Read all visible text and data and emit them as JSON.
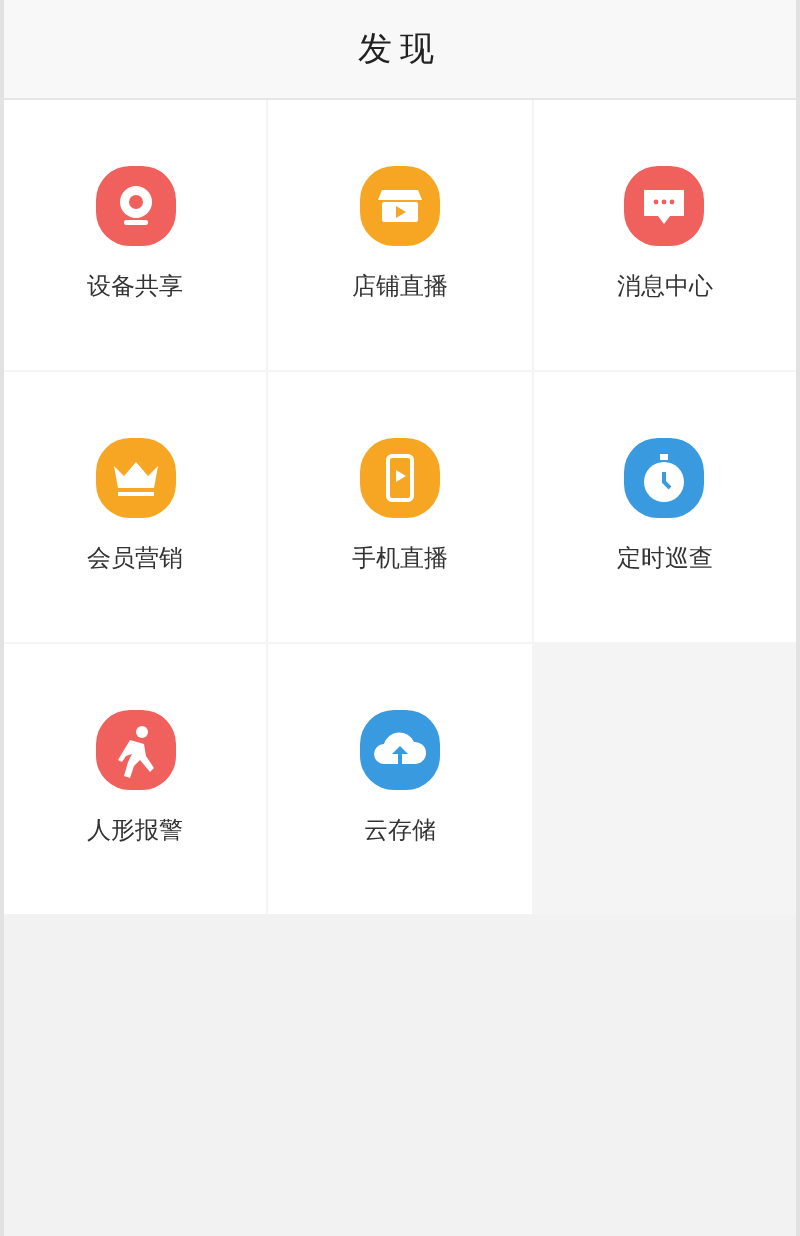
{
  "header": {
    "title": "发现"
  },
  "items": [
    {
      "label": "设备共享",
      "kind": "camera",
      "color": "#f0605c"
    },
    {
      "label": "店铺直播",
      "kind": "store",
      "color": "#f6a623"
    },
    {
      "label": "消息中心",
      "kind": "message",
      "color": "#f0605c"
    },
    {
      "label": "会员营销",
      "kind": "crown",
      "color": "#f6a623"
    },
    {
      "label": "手机直播",
      "kind": "phone",
      "color": "#f6a623"
    },
    {
      "label": "定时巡查",
      "kind": "timer",
      "color": "#3a9ae0"
    },
    {
      "label": "人形报警",
      "kind": "person",
      "color": "#f0605c"
    },
    {
      "label": "云存储",
      "kind": "cloud",
      "color": "#3a9ae0"
    }
  ]
}
